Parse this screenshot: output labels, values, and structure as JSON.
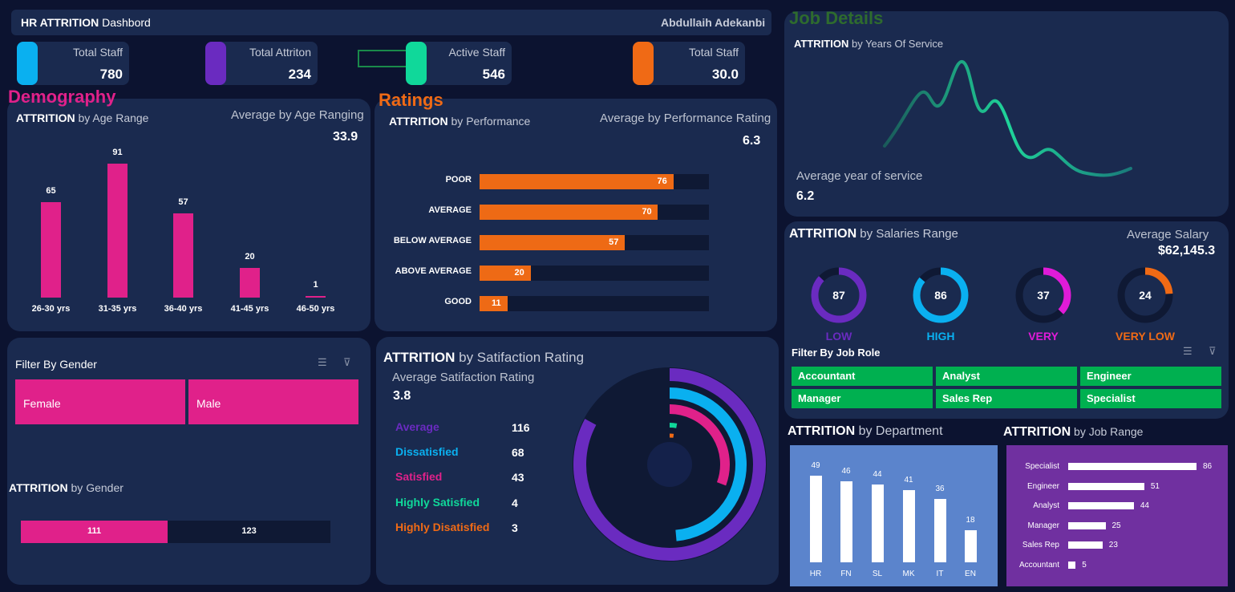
{
  "header": {
    "title_bold": "HR ATTRITION",
    "title_rest": " Dashbord",
    "author": "Abdullaih Adekanbi"
  },
  "kpis": [
    {
      "label": "Total Staff",
      "value": "780",
      "color": "#0ab0f0"
    },
    {
      "label": "Total Attriton",
      "value": "234",
      "color": "#6a2bc0"
    },
    {
      "label": "Active Staff",
      "value": "546",
      "color": "#10d89a"
    },
    {
      "label": "Total Staff",
      "value": "30.0",
      "color": "#f06a15"
    }
  ],
  "sections": {
    "demography": "Demography",
    "ratings": "Ratings",
    "job_details": "Job Details"
  },
  "age": {
    "title_bold": "ATTRITION",
    "title_rest": " by Age Range",
    "avg_label": "Average by Age Ranging",
    "avg_value": "33.9"
  },
  "performance": {
    "title_bold": "ATTRITION",
    "title_rest": " by Performance",
    "avg_label": "Average by Performance Rating",
    "avg_value": "6.3"
  },
  "service": {
    "title_bold": "ATTRITION",
    "title_rest": " by Years Of Service",
    "avg_label": "Average year of service",
    "avg_value": "6.2"
  },
  "gender_filter": {
    "title": "Filter By Gender",
    "options": [
      "Female",
      "Male"
    ]
  },
  "gender": {
    "title_bold": "ATTRITION",
    "title_rest": " by Gender",
    "values": [
      "111",
      "123"
    ]
  },
  "satisfaction": {
    "title_bold": "ATTRITION",
    "title_rest": " by Satifaction Rating",
    "avg_label": "Average Satifaction Rating",
    "avg_value": "3.8"
  },
  "salary": {
    "title_bold": "ATTRITION",
    "title_rest": " by Salaries Range",
    "avg_label": "Average Salary",
    "avg_value": "$62,145.3"
  },
  "job_role_filter": {
    "title": "Filter By Job Role",
    "options": [
      "Accountant",
      "Analyst",
      "Engineer",
      "Manager",
      "Sales Rep",
      "Specialist"
    ]
  },
  "department": {
    "title_bold": "ATTRITION",
    "title_rest": " by Department"
  },
  "job_range": {
    "title_bold": "ATTRITION",
    "title_rest": " by Job Range"
  },
  "chart_data": [
    {
      "id": "age_range",
      "type": "bar",
      "categories": [
        "26-30 yrs",
        "31-35 yrs",
        "36-40 yrs",
        "41-45 yrs",
        "46-50 yrs"
      ],
      "values": [
        65,
        91,
        57,
        20,
        1
      ],
      "color": "#e0218a"
    },
    {
      "id": "performance",
      "type": "bar",
      "orientation": "horizontal",
      "categories": [
        "POOR",
        "AVERAGE",
        "BELOW AVERAGE",
        "ABOVE AVERAGE",
        "GOOD"
      ],
      "values": [
        76,
        70,
        57,
        20,
        11
      ],
      "color": "#ee6a15"
    },
    {
      "id": "years_of_service",
      "type": "line",
      "color": "#1fd49a"
    },
    {
      "id": "gender",
      "type": "bar",
      "orientation": "horizontal",
      "stacked": true,
      "categories": [
        "Female",
        "Male"
      ],
      "values": [
        111,
        123
      ],
      "colors": [
        "#e0218a",
        "#0f1934"
      ]
    },
    {
      "id": "satisfaction",
      "type": "pie",
      "categories": [
        "Average",
        "Dissatisfied",
        "Satisfied",
        "Highly Satisfied",
        "Highly Disatisfied"
      ],
      "values": [
        116,
        68,
        43,
        4,
        3
      ],
      "colors": [
        "#6a2bc0",
        "#0ab0f0",
        "#e0218a",
        "#10d89a",
        "#f06a15"
      ]
    },
    {
      "id": "salaries",
      "type": "pie",
      "categories": [
        "LOW",
        "HIGH",
        "VERY",
        "VERY LOW"
      ],
      "values": [
        87,
        86,
        37,
        24
      ],
      "colors": [
        "#6a2bc0",
        "#0ab0f0",
        "#e01bd8",
        "#f06a15"
      ]
    },
    {
      "id": "department",
      "type": "bar",
      "categories": [
        "HR",
        "FN",
        "SL",
        "MK",
        "IT",
        "EN"
      ],
      "values": [
        49,
        46,
        44,
        41,
        36,
        18
      ]
    },
    {
      "id": "job_range",
      "type": "bar",
      "orientation": "horizontal",
      "categories": [
        "Specialist",
        "Engineer",
        "Analyst",
        "Manager",
        "Sales Rep",
        "Accountant"
      ],
      "values": [
        86,
        51,
        44,
        25,
        23,
        5
      ]
    }
  ]
}
